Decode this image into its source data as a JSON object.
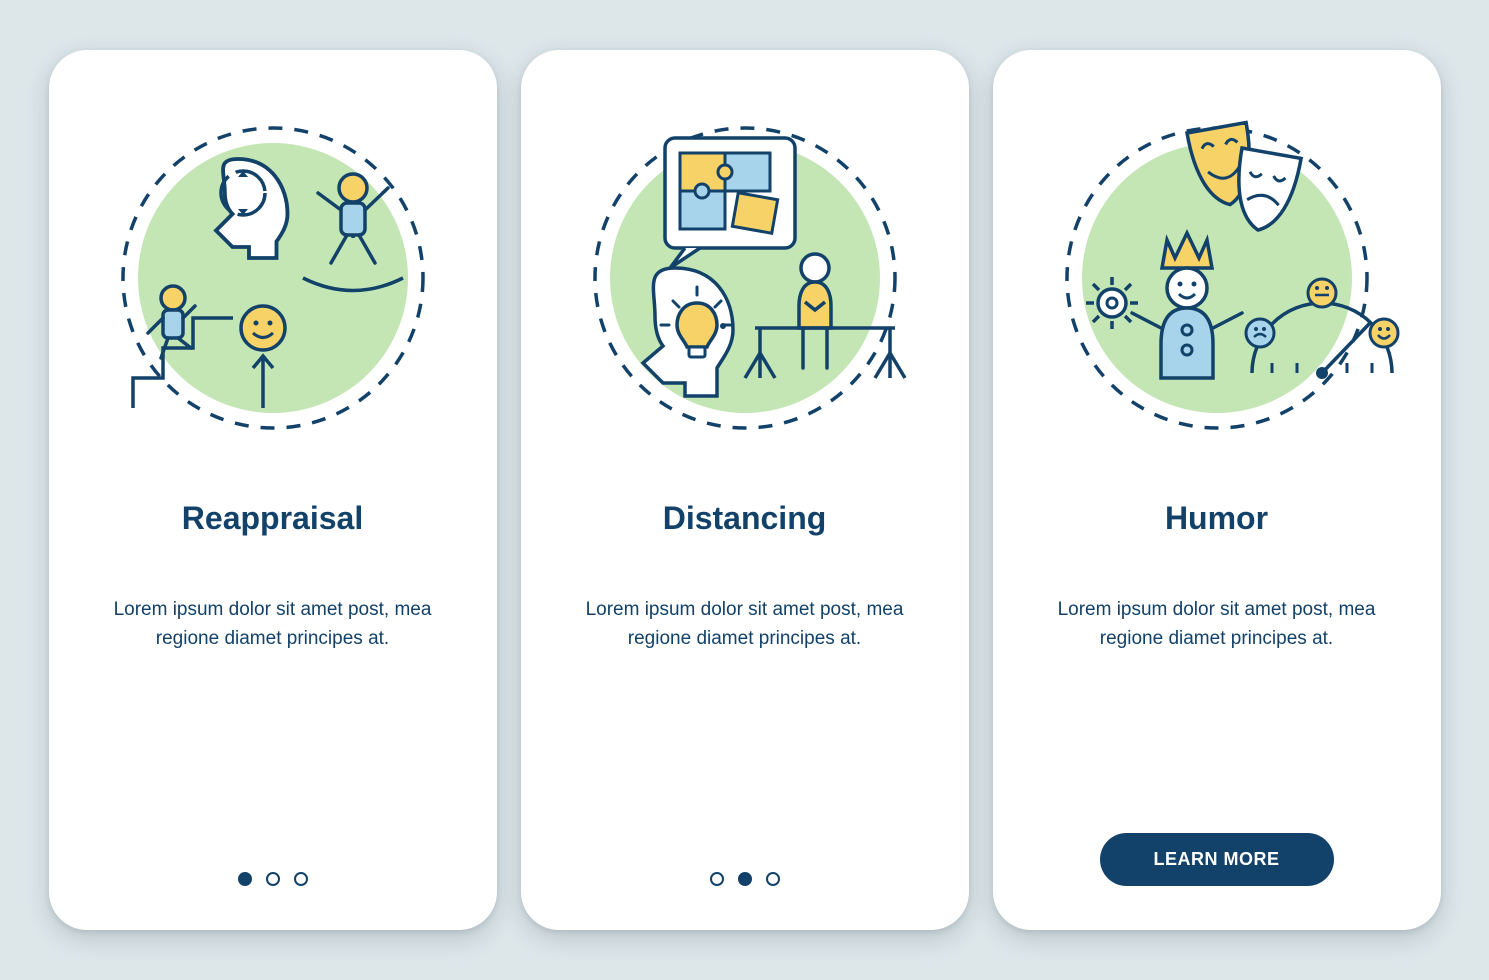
{
  "colors": {
    "background": "#dde7ea",
    "card": "#ffffff",
    "primary": "#124169",
    "accentGreen": "#c3e6b4",
    "accentYellow": "#f6d267",
    "accentBlue": "#a7d4ea"
  },
  "screens": [
    {
      "title": "Reappraisal",
      "body": "Lorem ipsum dolor sit amet post, mea regione diamet principes at.",
      "icon": "reappraisal-illustration",
      "footer": {
        "type": "dots",
        "count": 3,
        "activeIndex": 0
      }
    },
    {
      "title": "Distancing",
      "body": "Lorem ipsum dolor sit amet post, mea regione diamet principes at.",
      "icon": "distancing-illustration",
      "footer": {
        "type": "dots",
        "count": 3,
        "activeIndex": 1
      }
    },
    {
      "title": "Humor",
      "body": "Lorem ipsum dolor sit amet post, mea regione diamet principes at.",
      "icon": "humor-illustration",
      "footer": {
        "type": "button",
        "label": "LEARN MORE"
      }
    }
  ]
}
